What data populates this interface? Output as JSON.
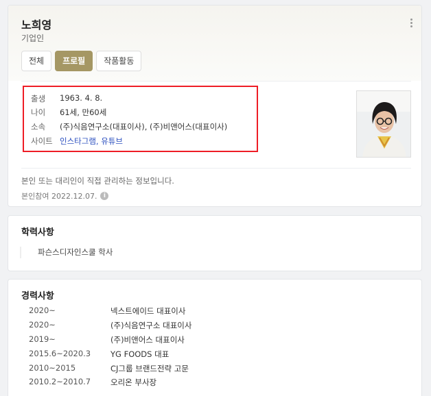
{
  "profile": {
    "name": "노희영",
    "subtitle": "기업인",
    "tabs": [
      {
        "label": "전체",
        "active": false
      },
      {
        "label": "프로필",
        "active": true
      },
      {
        "label": "작품활동",
        "active": false
      }
    ],
    "info": [
      {
        "key": "출생",
        "value": "1963. 4. 8."
      },
      {
        "key": "나이",
        "value": "61세, 만60세"
      },
      {
        "key": "소속",
        "value": "(주)식음연구소(대표이사), (주)비앤어스(대표이사)"
      },
      {
        "key": "사이트",
        "links": [
          "인스타그램",
          "유튜브"
        ]
      }
    ],
    "notice": "본인 또는 대리인이 직접 관리하는 정보입니다.",
    "joined": "본인참여 2022.12.07."
  },
  "education": {
    "title": "학력사항",
    "items": [
      "파슨스디자인스쿨 학사"
    ]
  },
  "career": {
    "title": "경력사항",
    "items": [
      {
        "year": "2020~",
        "desc": "넥스트에이드 대표이사"
      },
      {
        "year": "2020~",
        "desc": "(주)식음연구소 대표이사"
      },
      {
        "year": "2019~",
        "desc": "(주)비앤어스 대표이사"
      },
      {
        "year": "2015.6~2020.3",
        "desc": "YG FOODS 대표"
      },
      {
        "year": "2010~2015",
        "desc": "CJ그룹 브랜드전략 고문"
      },
      {
        "year": "2010.2~2010.7",
        "desc": "오리온 부사장"
      }
    ]
  },
  "colors": {
    "accent": "#a59764",
    "link": "#2b4fbf",
    "highlight": "#ee1c25"
  }
}
